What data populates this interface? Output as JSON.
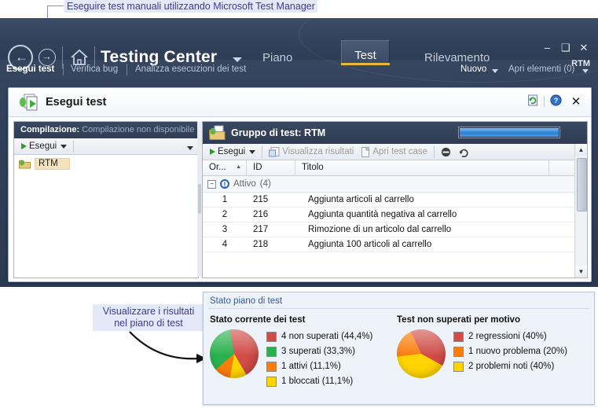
{
  "annotations": {
    "top_callout": "Eseguire test manuali utilizzando Microsoft Test Manager",
    "bottom_callout_line1": "Visualizzare i risultati",
    "bottom_callout_line2": "nel piano di test"
  },
  "window": {
    "app_title": "Testing Center",
    "tabs": [
      {
        "label": "Piano",
        "selected": false
      },
      {
        "label": "Test",
        "selected": true
      },
      {
        "label": "Rilevamento",
        "selected": false
      }
    ],
    "rtm_badge": "RTM",
    "controls": {
      "minimize": "–",
      "maximize": "❑",
      "close": "✕"
    },
    "subbar": {
      "items": [
        {
          "label": "Esegui test",
          "selected": true
        },
        {
          "label": "Verifica bug",
          "selected": false
        },
        {
          "label": "Analizza esecuzioni dei test",
          "selected": false
        }
      ],
      "right_items": [
        {
          "label": "Nuovo"
        },
        {
          "label": "Apri elementi (0)"
        }
      ]
    }
  },
  "panel": {
    "title": "Esegui test",
    "icons": {
      "refresh": "refresh-icon",
      "help": "?",
      "close": "✕"
    }
  },
  "left_pane": {
    "header_label": "Compilazione:",
    "header_value": "Compilazione non disponibile",
    "toolbar": {
      "run_label": "Esegui"
    },
    "tree": [
      {
        "label": "RTM",
        "selected": true
      }
    ]
  },
  "right_pane": {
    "group_title": "Gruppo di test: RTM",
    "progress_percent": 100,
    "toolbar": [
      {
        "label": "Esegui",
        "disabled": false
      },
      {
        "label": "Visualizza risultati",
        "disabled": true
      },
      {
        "label": "Apri test case",
        "disabled": true
      }
    ],
    "columns": [
      "Or...",
      "ID",
      "Titolo"
    ],
    "sort_indicator": "▲",
    "group_row": {
      "label": "Attivo",
      "count": "(4)",
      "expander": "−"
    },
    "rows": [
      {
        "ord": "1",
        "id": "215",
        "title": "Aggiunta articoli al carrello"
      },
      {
        "ord": "2",
        "id": "216",
        "title": "Aggiunta quantità negativa al carrello"
      },
      {
        "ord": "3",
        "id": "217",
        "title": "Rimozione di un articolo dal carrello"
      },
      {
        "ord": "4",
        "id": "218",
        "title": "Aggiunta 100 articoli al carrello"
      }
    ],
    "scroll": {
      "up": "▲",
      "down": "▼"
    }
  },
  "results": {
    "header": "Stato piano di test"
  },
  "chart_data": [
    {
      "type": "pie",
      "title": "Stato corrente dei test",
      "categories": [
        "4 non superati (44,4%)",
        "3 superati (33,3%)",
        "1 attivi (11,1%)",
        "1 bloccati (11,1%)"
      ],
      "values": [
        44.4,
        33.3,
        11.1,
        11.1
      ],
      "counts": [
        4,
        3,
        1,
        1
      ],
      "colors": [
        "#d14b47",
        "#28b14c",
        "#f97d0a",
        "#ffd400"
      ],
      "legend": "right",
      "start_angle": -10
    },
    {
      "type": "pie",
      "title": "Test non superati per motivo",
      "categories": [
        "2 regressioni (40%)",
        "1 nuovo problema (20%)",
        "2 problemi noti (40%)"
      ],
      "values": [
        40,
        20,
        40
      ],
      "counts": [
        2,
        1,
        2
      ],
      "colors": [
        "#d14b47",
        "#f97d0a",
        "#ffd400"
      ],
      "legend": "right",
      "start_angle": -25
    }
  ]
}
